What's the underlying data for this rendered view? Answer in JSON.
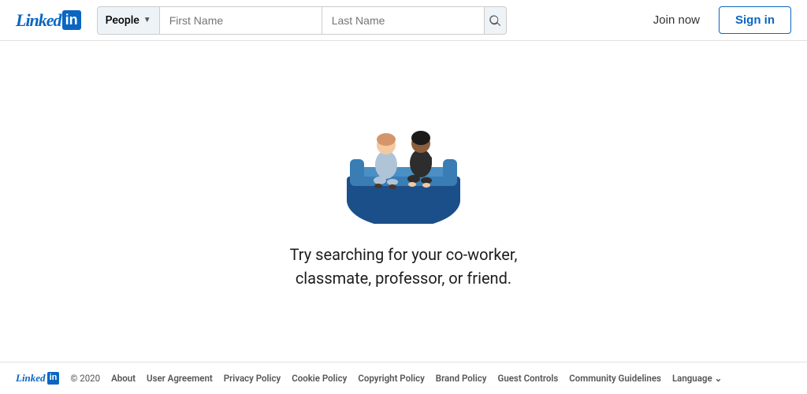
{
  "header": {
    "logo_text": "Linked",
    "logo_in": "in",
    "search": {
      "category_label": "People",
      "first_name_placeholder": "First Name",
      "last_name_placeholder": "Last Name"
    },
    "join_now_label": "Join now",
    "sign_in_label": "Sign in"
  },
  "main": {
    "empty_line1": "Try searching for your co-worker,",
    "empty_line2": "classmate, professor, or friend."
  },
  "footer": {
    "logo_text": "Linked",
    "logo_in": "in",
    "copyright": "© 2020",
    "links": [
      "About",
      "User Agreement",
      "Privacy Policy",
      "Cookie Policy",
      "Copyright Policy",
      "Brand Policy",
      "Guest Controls",
      "Community Guidelines",
      "Language"
    ]
  }
}
